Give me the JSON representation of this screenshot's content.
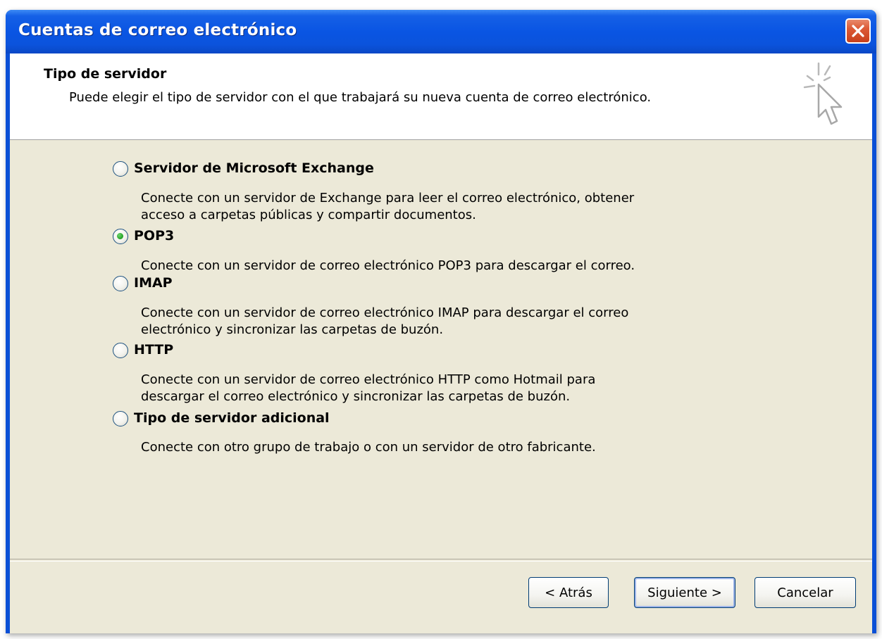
{
  "window": {
    "title": "Cuentas de correo electrónico"
  },
  "header": {
    "title": "Tipo de servidor",
    "subtitle": "Puede elegir el tipo de servidor con el que trabajará su nueva cuenta de correo electrónico."
  },
  "options": [
    {
      "label": "Servidor de Microsoft Exchange",
      "desc_line1": "Conecte con un servidor de Exchange para leer el correo electrónico, obtener",
      "desc_line2": "acceso a carpetas públicas y compartir documentos.",
      "selected": false
    },
    {
      "label": "POP3",
      "desc_line1": "Conecte con un servidor de correo electrónico POP3 para descargar el correo.",
      "selected": true
    },
    {
      "label": "IMAP",
      "desc_line1": "Conecte con un servidor de correo electrónico IMAP para descargar el correo",
      "desc_line2": "electrónico y sincronizar las carpetas de buzón.",
      "selected": false
    },
    {
      "label": "HTTP",
      "desc_line1": "Conecte con un servidor de correo electrónico HTTP como Hotmail para",
      "desc_line2": "descargar el correo electrónico y sincronizar las carpetas de buzón.",
      "selected": false
    },
    {
      "label": "Tipo de servidor adicional",
      "desc_line1": "Conecte con otro grupo de trabajo o con un servidor de otro fabricante.",
      "selected": false
    }
  ],
  "buttons": {
    "back": "< Atrás",
    "next": "Siguiente >",
    "cancel": "Cancelar"
  },
  "colors": {
    "titlebar": "#0a55e3",
    "client_bg": "#ece9d8",
    "close": "#dc5a36"
  }
}
